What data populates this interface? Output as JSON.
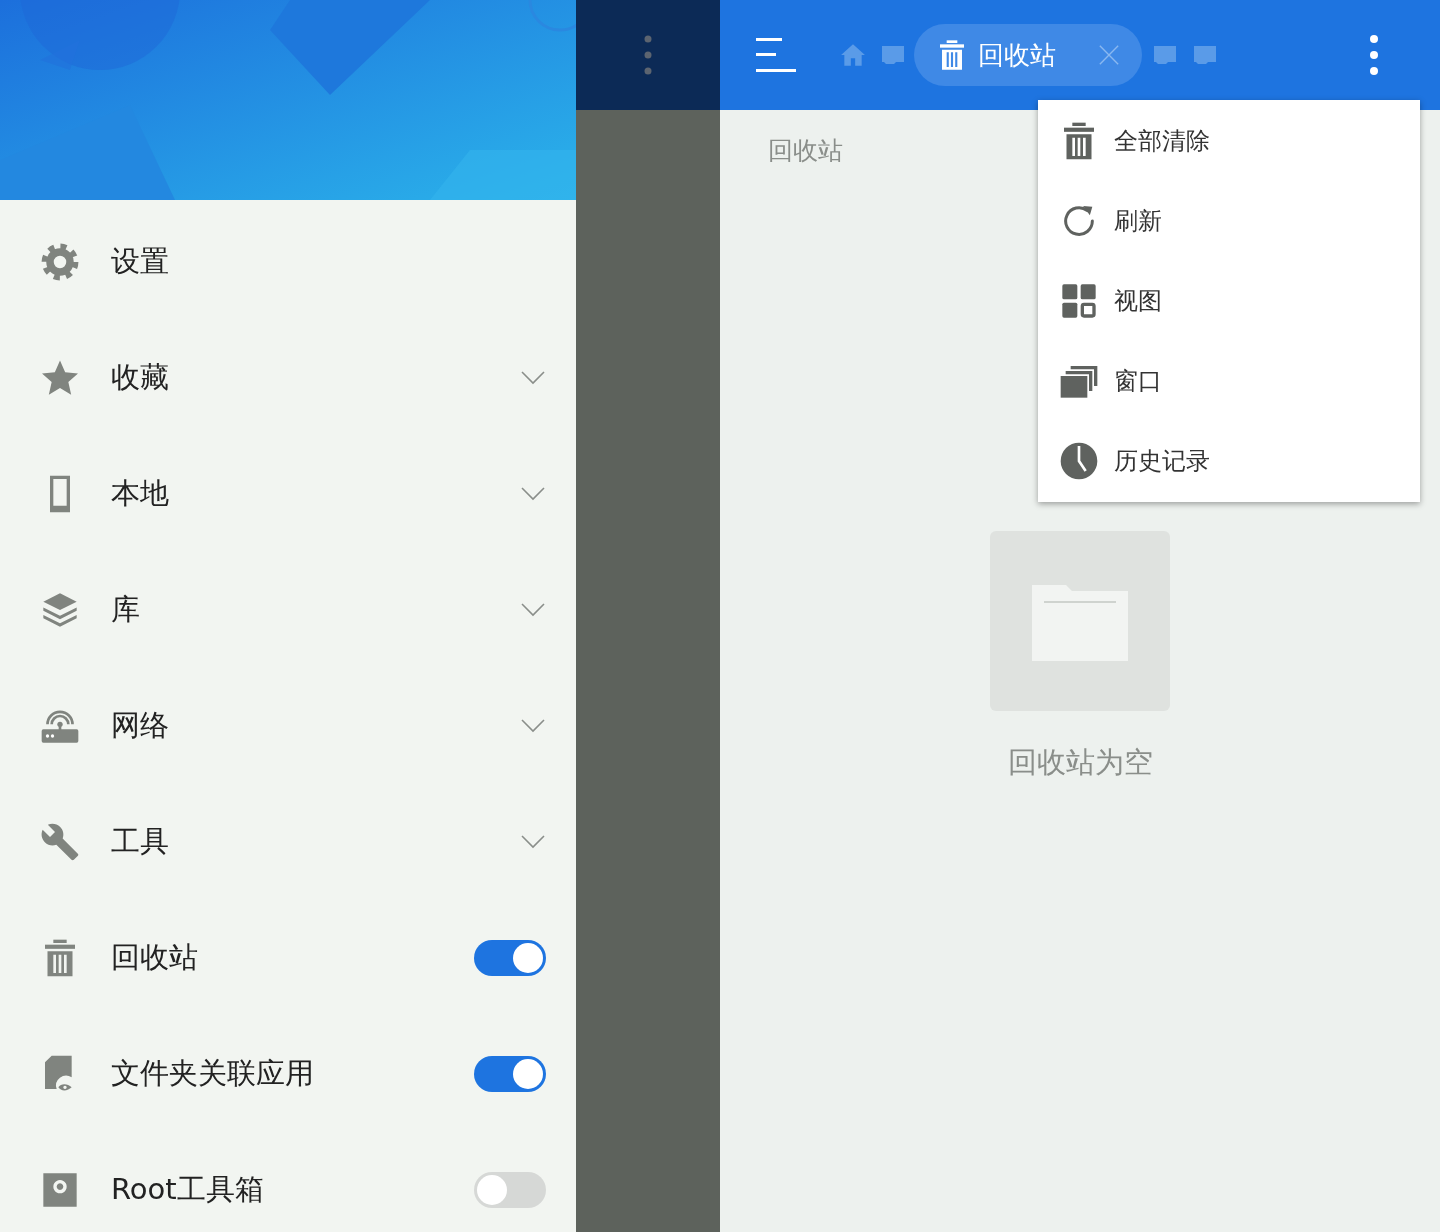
{
  "drawer": {
    "items": [
      {
        "kind": "nav",
        "label": "设置"
      },
      {
        "kind": "expand",
        "label": "收藏",
        "expanded": false
      },
      {
        "kind": "expand",
        "label": "本地",
        "expanded": false
      },
      {
        "kind": "expand",
        "label": "库",
        "expanded": false
      },
      {
        "kind": "expand",
        "label": "网络",
        "expanded": false
      },
      {
        "kind": "expand",
        "label": "工具",
        "expanded": false
      },
      {
        "kind": "toggle",
        "label": "回收站",
        "on": true
      },
      {
        "kind": "toggle",
        "label": "文件夹关联应用",
        "on": true
      },
      {
        "kind": "toggle",
        "label": "Root工具箱",
        "on": false
      }
    ]
  },
  "toolbar": {
    "tab": {
      "label": "回收站"
    }
  },
  "path": "回收站",
  "empty": {
    "message": "回收站为空"
  },
  "menu": {
    "items": [
      {
        "label": "全部清除"
      },
      {
        "label": "刷新"
      },
      {
        "label": "视图"
      },
      {
        "label": "窗口"
      },
      {
        "label": "历史记录"
      }
    ]
  }
}
